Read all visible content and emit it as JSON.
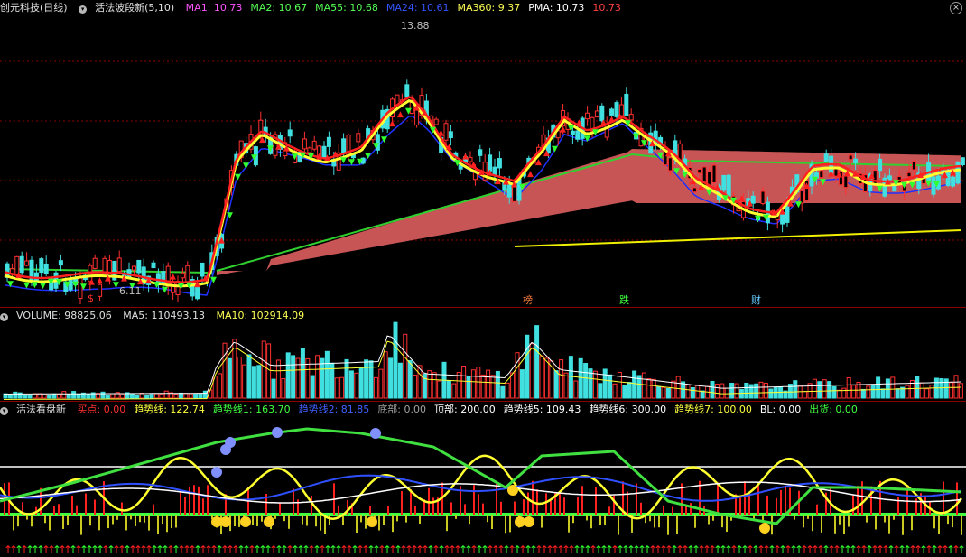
{
  "main": {
    "stock": "创元科技(日线)",
    "indicator": "活法波段新(5,10)",
    "legend": [
      {
        "label": "MA1: 10.73",
        "color": "#ff55ff"
      },
      {
        "label": "MA2: 10.67",
        "color": "#55ff55"
      },
      {
        "label": "MA55: 10.68",
        "color": "#55ff55"
      },
      {
        "label": "MA24: 10.61",
        "color": "#3355ff"
      },
      {
        "label": "MA360: 9.37",
        "color": "#ffff55"
      },
      {
        "label": "PMA: 10.73",
        "color": "#ffffff"
      },
      {
        "label": "10.73",
        "color": "#ff4040"
      }
    ],
    "high_label": "13.88",
    "low_label": "6.11",
    "markers": [
      {
        "text": "$",
        "color": "#ff3030"
      },
      {
        "text": "榜",
        "color": "#ff8040"
      },
      {
        "text": "跌",
        "color": "#40ff40"
      },
      {
        "text": "财",
        "color": "#66ccff"
      }
    ],
    "close_button": "×"
  },
  "volume": {
    "title": "VOLUME: 98825.06",
    "ma5": "MA5: 110493.13",
    "ma10": "MA10: 102914.09"
  },
  "sub": {
    "title": "活法看盘新",
    "items": [
      {
        "label": "买点: 0.00",
        "color": "#ff3030"
      },
      {
        "label": "趋势线: 122.74",
        "color": "#ffff40"
      },
      {
        "label": "趋势线1: 163.70",
        "color": "#40ff40"
      },
      {
        "label": "趋势线2: 81.85",
        "color": "#4060ff"
      },
      {
        "label": "底部: 0.00",
        "color": "#a0a0a0"
      },
      {
        "label": "顶部: 200.00",
        "color": "#ffffff"
      },
      {
        "label": "趋势线5: 109.43",
        "color": "#ffffff"
      },
      {
        "label": "趋势线6: 300.00",
        "color": "#ffffff"
      },
      {
        "label": "趋势线7: 100.00",
        "color": "#ffff40"
      },
      {
        "label": "BL: 0.00",
        "color": "#ffffff"
      },
      {
        "label": "出货: 0.00",
        "color": "#40ff40"
      }
    ]
  }
}
